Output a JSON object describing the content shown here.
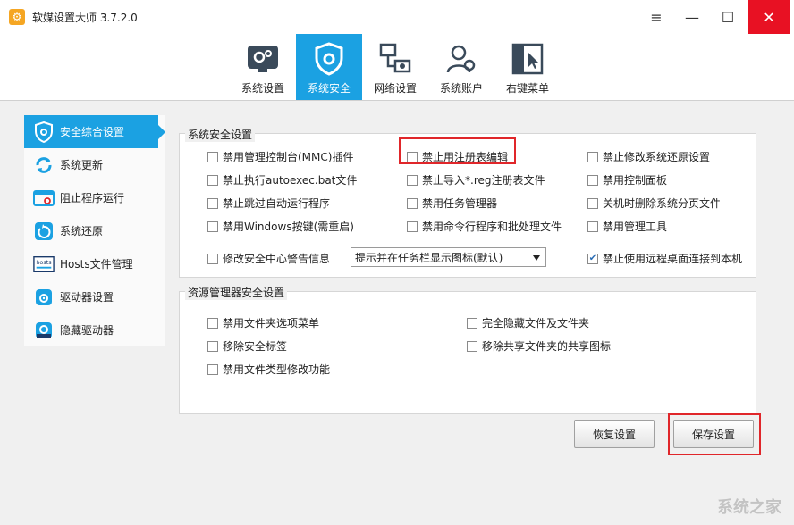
{
  "window": {
    "title": "软媒设置大师 3.7.2.0",
    "logo_glyph": "⚙",
    "menu_glyph": "≡",
    "minimize_glyph": "—",
    "maximize_glyph": "☐",
    "close_glyph": "✕"
  },
  "toolbar": {
    "tabs": [
      {
        "label": "系统设置",
        "icon": "settings-screen-icon"
      },
      {
        "label": "系统安全",
        "icon": "shield-icon"
      },
      {
        "label": "网络设置",
        "icon": "network-icon"
      },
      {
        "label": "系统账户",
        "icon": "users-icon"
      },
      {
        "label": "右键菜单",
        "icon": "context-menu-icon"
      }
    ],
    "active_tab": "系统安全"
  },
  "sidebar": {
    "items": [
      {
        "label": "安全综合设置",
        "icon": "shield-icon",
        "active": true
      },
      {
        "label": "系统更新",
        "icon": "refresh-icon"
      },
      {
        "label": "阻止程序运行",
        "icon": "block-window-icon"
      },
      {
        "label": "系统还原",
        "icon": "restore-icon"
      },
      {
        "label": "Hosts文件管理",
        "icon": "hosts-icon"
      },
      {
        "label": "驱动器设置",
        "icon": "drive-icon"
      },
      {
        "label": "隐藏驱动器",
        "icon": "hide-drive-icon"
      }
    ]
  },
  "system_security": {
    "title": "系统安全设置",
    "options": [
      {
        "label": "禁用管理控制台(MMC)插件",
        "checked": false
      },
      {
        "label": "禁止用注册表编辑",
        "checked": false
      },
      {
        "label": "禁止修改系统还原设置",
        "checked": false
      },
      {
        "label": "禁止执行autoexec.bat文件",
        "checked": false
      },
      {
        "label": "禁止导入*.reg注册表文件",
        "checked": false
      },
      {
        "label": "禁用控制面板",
        "checked": false
      },
      {
        "label": "禁止跳过自动运行程序",
        "checked": false
      },
      {
        "label": "禁用任务管理器",
        "checked": false
      },
      {
        "label": "关机时删除系统分页文件",
        "checked": false
      },
      {
        "label": "禁用Windows按键(需重启)",
        "checked": false
      },
      {
        "label": "禁用命令行程序和批处理文件",
        "checked": false
      },
      {
        "label": "禁用管理工具",
        "checked": false
      },
      {
        "label": "修改安全中心警告信息",
        "checked": false
      },
      {
        "label": "禁止使用远程桌面连接到本机",
        "checked": true
      }
    ],
    "alert_select": {
      "value": "提示并在任务栏显示图标(默认)"
    }
  },
  "explorer_security": {
    "title": "资源管理器安全设置",
    "options": [
      {
        "label": "禁用文件夹选项菜单",
        "checked": false
      },
      {
        "label": "完全隐藏文件及文件夹",
        "checked": false
      },
      {
        "label": "移除安全标签",
        "checked": false
      },
      {
        "label": "移除共享文件夹的共享图标",
        "checked": false
      },
      {
        "label": "禁用文件类型修改功能",
        "checked": false
      }
    ]
  },
  "actions": {
    "restore_label": "恢复设置",
    "save_label": "保存设置"
  },
  "colors": {
    "accent": "#1ba1e2",
    "highlight_red": "#e0262a",
    "close_red": "#e81123"
  },
  "watermark": "系统之家"
}
